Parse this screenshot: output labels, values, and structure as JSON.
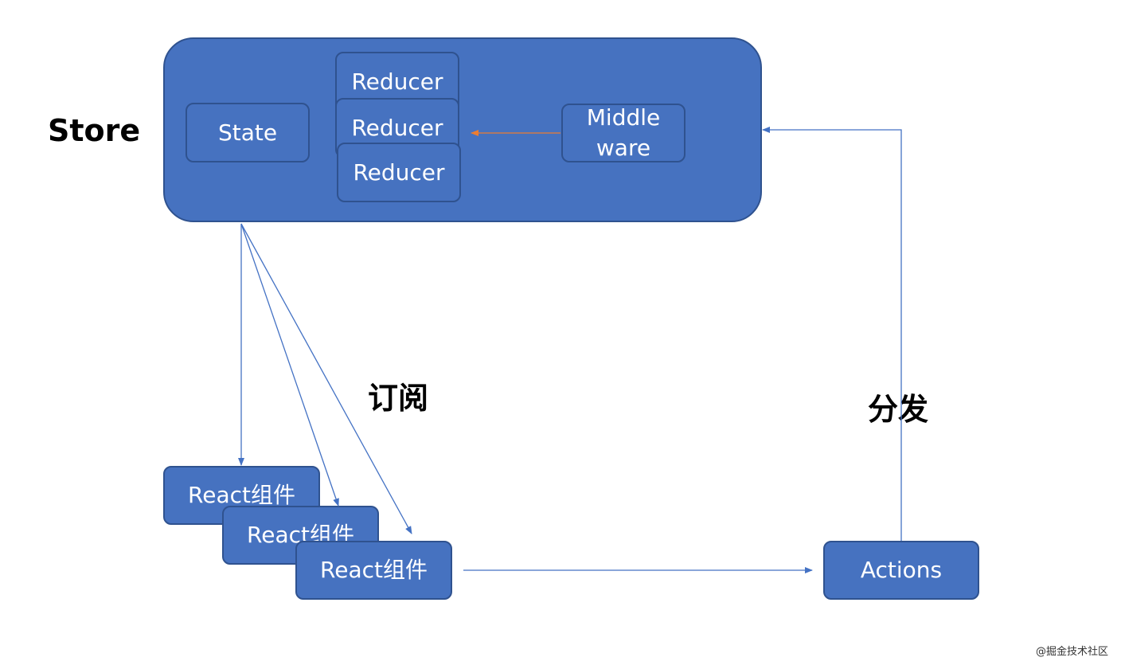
{
  "store": {
    "title": "Store",
    "state_label": "State",
    "reducers": [
      "Reducer",
      "Reducer",
      "Reducer"
    ],
    "middleware_label": "Middle ware"
  },
  "components": {
    "react_labels": [
      "React组件",
      "React组件",
      "React组件"
    ]
  },
  "actions": {
    "label": "Actions"
  },
  "flow_labels": {
    "subscribe": "订阅",
    "dispatch": "分发"
  },
  "watermark": "@掘金技术社区",
  "colors": {
    "box_fill": "#4672c0",
    "box_border": "#2f528f",
    "arrow_blue": "#4472c4",
    "arrow_orange": "#ed7d31"
  }
}
